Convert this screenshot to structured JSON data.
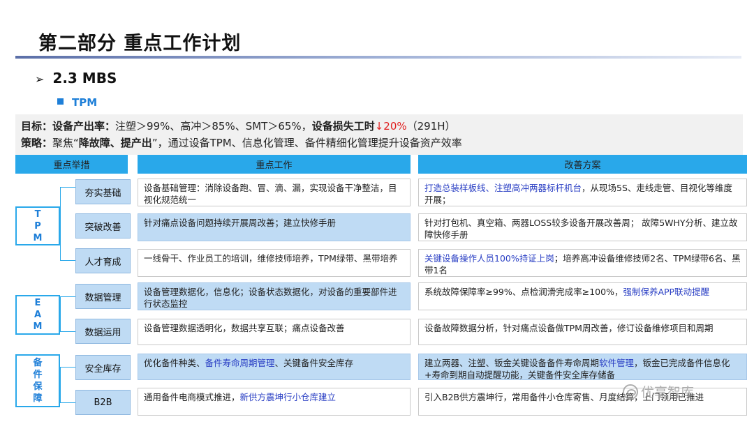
{
  "page_title": "第二部分 重点工作计划",
  "section": {
    "arrow": "➢",
    "label": "2.3 MBS"
  },
  "subsection": {
    "label": "TPM"
  },
  "goal": {
    "label": "目标：",
    "metric1": "设备产出率：",
    "text1": "注塑＞99%、高冲＞85%、SMT＞65%，",
    "metric2": "设备损失工时",
    "red": "↓20%",
    "text2": "（291H）"
  },
  "strategy": {
    "label": "策略：",
    "t1": "聚焦“",
    "bold": "降故障、提产出",
    "t2": "”，通过设备TPM、信息化管理、备件精细化管理提升设备资产效率"
  },
  "headers": {
    "measures": "重点举措",
    "work": "重点工作",
    "plan": "改善方案"
  },
  "groups": [
    {
      "label": "T P M"
    },
    {
      "label": "E A M"
    },
    {
      "label": "备件保障"
    }
  ],
  "rows": [
    {
      "item": "夯实基础",
      "work": [
        {
          "t": "设备基础管理：消除设备跑、冒、滴、漏，实现设备干净整洁，目视化规范统一"
        }
      ],
      "plan": [
        {
          "t": "打造总装样板线、注塑高冲两器标杆机台",
          "hl": true
        },
        {
          "t": "，从现场5S、走线走管、目视化等维度开展；"
        }
      ]
    },
    {
      "item": "突破改善",
      "work": [
        {
          "t": "针对痛点设备问题持续开展周改善；建立快修手册"
        }
      ],
      "plan": [
        {
          "t": "针对打包机、真空箱、两器LOSS较多设备开展改善周； 故障5WHY分析、建立故障快修手册"
        }
      ]
    },
    {
      "item": "人才育成",
      "work": [
        {
          "t": "一线骨干、作业员工的培训，维修技师培养，TPM绿带、黑带培养"
        }
      ],
      "plan": [
        {
          "t": "关键设备操作人员100%持证上岗",
          "hl": true
        },
        {
          "t": "；培养高冲设备维修技师2名、TPM绿带6名、黑带1名"
        }
      ]
    },
    {
      "item": "数据管理",
      "work": [
        {
          "t": "设备管理数据化，信息化；设备状态数据化，对设备的重要部件进行状态监控"
        }
      ],
      "plan": [
        {
          "t": "系统故障保障率≥99%、点检润滑完成率≥100%，"
        },
        {
          "t": "强制保养APP联动提醒",
          "hl": true
        }
      ]
    },
    {
      "item": "数据运用",
      "work": [
        {
          "t": "设备管理数据透明化，数据共享互联；痛点设备改善"
        }
      ],
      "plan": [
        {
          "t": "设备故障数据分析，针对痛点设备做TPM周改善，修订设备维修项目和周期"
        }
      ]
    },
    {
      "item": "安全库存",
      "work": [
        {
          "t": "优化备件种类、"
        },
        {
          "t": "备件寿命周期管理",
          "hl": true
        },
        {
          "t": "、关键备件安全库存"
        }
      ],
      "plan": [
        {
          "t": "建立两器、注塑、钣金关键设备备件寿命周期"
        },
        {
          "t": "软件管理",
          "hl": true
        },
        {
          "t": "，钣金已完成备件信息化+寿命到期自动提醒功能，关键备件安全库存储备"
        }
      ]
    },
    {
      "item": "B2B",
      "work": [
        {
          "t": "通用备件电商模式推进，"
        },
        {
          "t": "新供方震坤行小仓库建立",
          "hl": true
        }
      ],
      "plan": [
        {
          "t": "引入B2B供方震坤行，常用备件小仓库寄售、月度结算，上门领用已推进"
        }
      ]
    }
  ],
  "watermark": "优享智库",
  "colors": {
    "header_blue": "#29a8ea",
    "item_blue": "#bfdbf4",
    "highlight": "#2a3fc4",
    "red": "#e02020"
  }
}
